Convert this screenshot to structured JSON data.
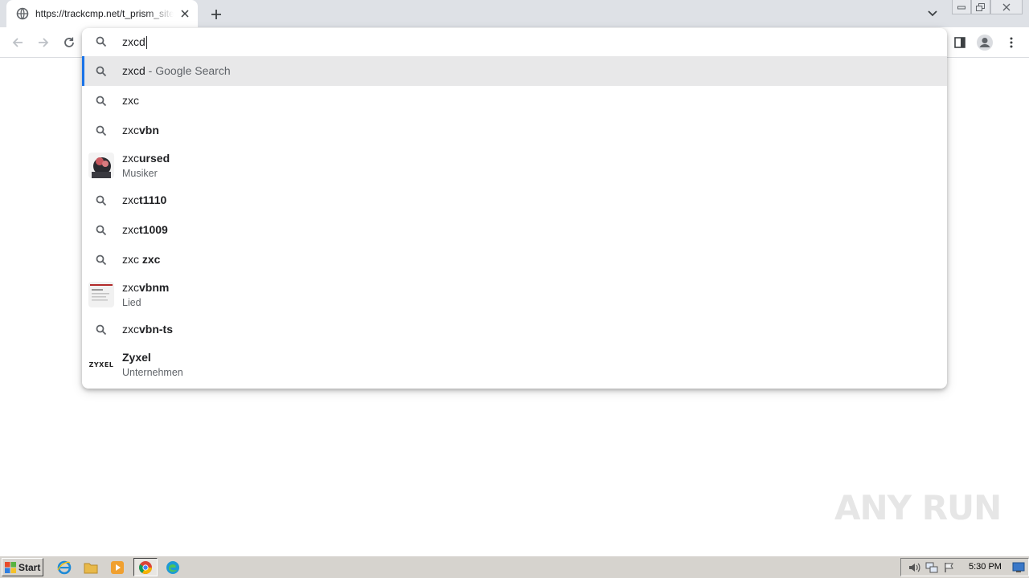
{
  "browser": {
    "tab": {
      "title": "https://trackcmp.net/t_prism_sitemap",
      "favicon": "globe-icon"
    },
    "omnibox": {
      "value": "zxcd"
    }
  },
  "suggestions": [
    {
      "typed": "zxcd",
      "rest": "",
      "suffix": " - Google Search",
      "subtitle": "",
      "kind": "search",
      "selected": true
    },
    {
      "typed": "zxc",
      "rest": "",
      "suffix": "",
      "subtitle": "",
      "kind": "search"
    },
    {
      "typed": "zxc",
      "rest": "vbn",
      "suffix": "",
      "subtitle": "",
      "kind": "search"
    },
    {
      "typed": "zxc",
      "rest": "ursed",
      "suffix": "",
      "subtitle": "Musiker",
      "kind": "entity"
    },
    {
      "typed": "zxc",
      "rest": "t1110",
      "suffix": "",
      "subtitle": "",
      "kind": "search"
    },
    {
      "typed": "zxc",
      "rest": "t1009",
      "suffix": "",
      "subtitle": "",
      "kind": "search"
    },
    {
      "typed": "zxc ",
      "rest": "zxc",
      "suffix": "",
      "subtitle": "",
      "kind": "search"
    },
    {
      "typed": "zxc",
      "rest": "vbnm",
      "suffix": "",
      "subtitle": "Lied",
      "kind": "entity"
    },
    {
      "typed": "zxc",
      "rest": "vbn-ts",
      "suffix": "",
      "subtitle": "",
      "kind": "search"
    },
    {
      "typed": "",
      "rest": "Zyxel",
      "suffix": "",
      "subtitle": "Unternehmen",
      "kind": "entity",
      "logo_text": "ZYXEL"
    }
  ],
  "watermark": "ANY RUN",
  "taskbar": {
    "start_label": "Start",
    "clock": "5:30 PM"
  },
  "colors": {
    "accent": "#1a73e8",
    "selected_row": "#e8e8e9",
    "tabstrip": "#dee1e6"
  }
}
